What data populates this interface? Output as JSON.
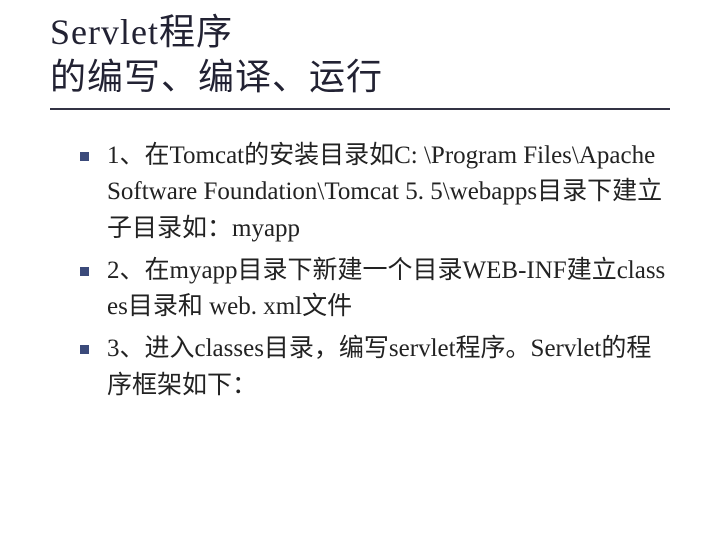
{
  "title": {
    "line1": "Servlet程序",
    "line2": "的编写、编译、运行"
  },
  "bullets": [
    {
      "text": "1、在Tomcat的安装目录如C: \\Program Files\\Apache Software Foundation\\Tomcat 5. 5\\webapps目录下建立子目录如：myapp"
    },
    {
      "text": "2、在myapp目录下新建一个目录WEB-INF建立classes目录和 web. xml文件"
    },
    {
      "text": "3、进入classes目录，编写servlet程序。Servlet的程序框架如下："
    }
  ]
}
